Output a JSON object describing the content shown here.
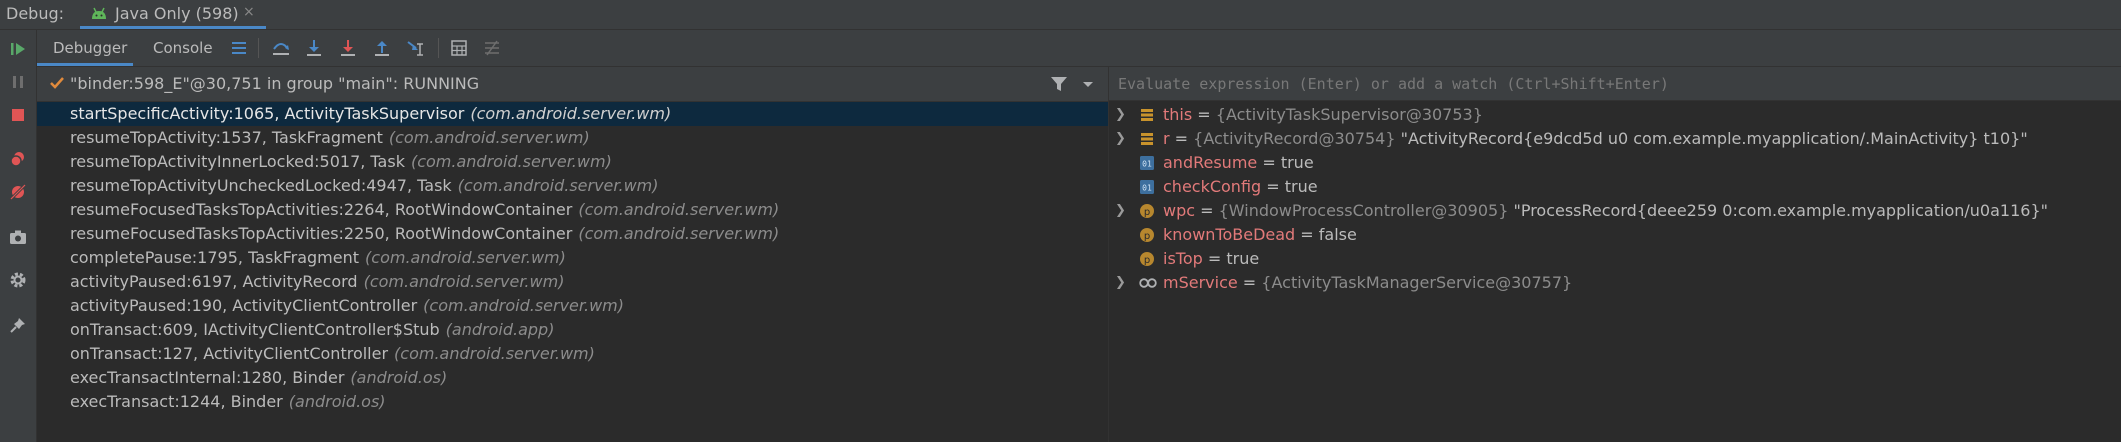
{
  "titlebar": {
    "debug_label": "Debug:",
    "session_tab": "Java Only (598)",
    "close_glyph": "×"
  },
  "toolbar": {
    "tabs": [
      {
        "label": "Debugger",
        "active": true
      },
      {
        "label": "Console",
        "active": false
      }
    ],
    "icons": [
      "layout-icon",
      "step-over-icon",
      "step-into-icon",
      "force-step-into-icon",
      "step-out-icon",
      "run-to-cursor-icon",
      "evaluate-expression-icon",
      "trace-icon"
    ]
  },
  "leftbar": {
    "icons": [
      "resume-icon",
      "pause-icon",
      "stop-icon",
      "view-breakpoints-icon",
      "mute-breakpoints-icon",
      "camera-icon",
      "settings-icon",
      "pin-icon"
    ]
  },
  "frames": {
    "thread": "\"binder:598_E\"@30,751 in group \"main\": RUNNING",
    "items": [
      {
        "method": "startSpecificActivity:1065, ActivityTaskSupervisor",
        "pkg": "(com.android.server.wm)"
      },
      {
        "method": "resumeTopActivity:1537, TaskFragment",
        "pkg": "(com.android.server.wm)"
      },
      {
        "method": "resumeTopActivityInnerLocked:5017, Task",
        "pkg": "(com.android.server.wm)"
      },
      {
        "method": "resumeTopActivityUncheckedLocked:4947, Task",
        "pkg": "(com.android.server.wm)"
      },
      {
        "method": "resumeFocusedTasksTopActivities:2264, RootWindowContainer",
        "pkg": "(com.android.server.wm)"
      },
      {
        "method": "resumeFocusedTasksTopActivities:2250, RootWindowContainer",
        "pkg": "(com.android.server.wm)"
      },
      {
        "method": "completePause:1795, TaskFragment",
        "pkg": "(com.android.server.wm)"
      },
      {
        "method": "activityPaused:6197, ActivityRecord",
        "pkg": "(com.android.server.wm)"
      },
      {
        "method": "activityPaused:190, ActivityClientController",
        "pkg": "(com.android.server.wm)"
      },
      {
        "method": "onTransact:609, IActivityClientController$Stub",
        "pkg": "(android.app)"
      },
      {
        "method": "onTransact:127, ActivityClientController",
        "pkg": "(com.android.server.wm)"
      },
      {
        "method": "execTransactInternal:1280, Binder",
        "pkg": "(android.os)"
      },
      {
        "method": "execTransact:1244, Binder",
        "pkg": "(android.os)"
      }
    ]
  },
  "variables": {
    "eval_placeholder": "Evaluate expression (Enter) or add a watch (Ctrl+Shift+Enter)",
    "items": [
      {
        "expandable": true,
        "icon": "field-icon",
        "name": "this",
        "eq": " = ",
        "type": "{ActivityTaskSupervisor@30753}",
        "value": ""
      },
      {
        "expandable": true,
        "icon": "field-icon",
        "name": "r",
        "eq": " = ",
        "type": "{ActivityRecord@30754}",
        "value": " \"ActivityRecord{e9dcd5d u0 com.example.myapplication/.MainActivity} t10}\""
      },
      {
        "expandable": false,
        "icon": "primitive-icon",
        "name": "andResume",
        "eq": " = ",
        "type": "",
        "value": "true"
      },
      {
        "expandable": false,
        "icon": "primitive-icon",
        "name": "checkConfig",
        "eq": " = ",
        "type": "",
        "value": "true"
      },
      {
        "expandable": true,
        "icon": "parameter-icon",
        "name": "wpc",
        "eq": " = ",
        "type": "{WindowProcessController@30905}",
        "value": " \"ProcessRecord{deee259 0:com.example.myapplication/u0a116}\""
      },
      {
        "expandable": false,
        "icon": "parameter-icon",
        "name": "knownToBeDead",
        "eq": " = ",
        "type": "",
        "value": "false"
      },
      {
        "expandable": false,
        "icon": "parameter-icon",
        "name": "isTop",
        "eq": " = ",
        "type": "",
        "value": "true"
      },
      {
        "expandable": true,
        "icon": "watch-icon",
        "name": "mService",
        "eq": " = ",
        "type": "{ActivityTaskManagerService@30757}",
        "value": ""
      }
    ]
  }
}
